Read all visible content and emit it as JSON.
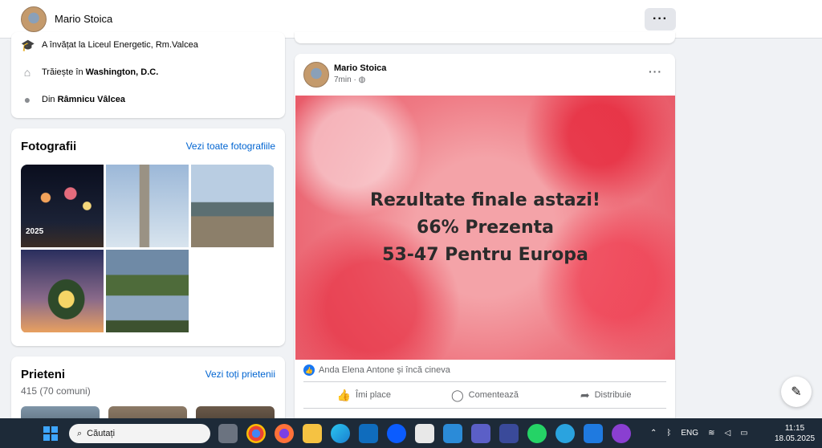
{
  "header": {
    "profile_name": "Mario Stoica",
    "more_label": "···"
  },
  "intro": {
    "education": "A învățat la Liceul Energetic, Rm.Valcea",
    "lives_prefix": "Trăiește în",
    "lives_place": "Washington, D.C.",
    "from_prefix": "Din",
    "from_place": "Râmnicu Vâlcea"
  },
  "photos": {
    "title": "Fotografii",
    "see_all": "Vezi toate fotografiile",
    "photo1_caption": "2025"
  },
  "friends": {
    "title": "Prieteni",
    "see_all": "Vezi toți prietenii",
    "count": "415 (70 comuni)"
  },
  "post": {
    "author": "Mario Stoica",
    "time": "7min",
    "more_label": "···",
    "banner_lines": [
      "Rezultate finale astazi!",
      "66% Prezenta",
      "53-47 Pentru Europa"
    ],
    "reactions_text": "Anda Elena Antone și încă cineva",
    "actions": {
      "like": "Îmi place",
      "comment": "Comentează",
      "share": "Distribuie"
    }
  },
  "taskbar": {
    "search_placeholder": "Căutați",
    "language": "ENG",
    "time": "11:15",
    "date": "18.05.2025"
  },
  "colors": {
    "accent": "#1877f2",
    "link": "#0064d1",
    "taskbar": "#1d2a38"
  }
}
